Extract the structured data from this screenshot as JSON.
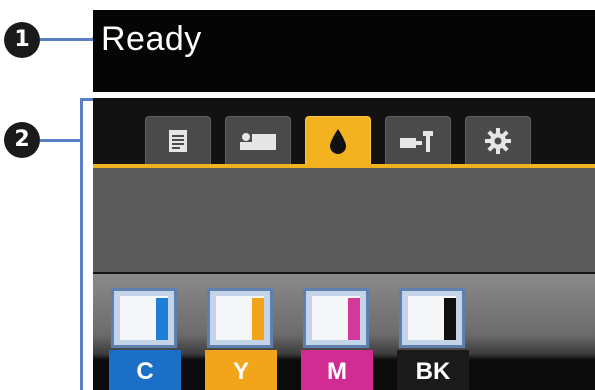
{
  "status": {
    "text": "Ready"
  },
  "callouts": [
    {
      "number": "1"
    },
    {
      "number": "2"
    }
  ],
  "tabs": [
    {
      "icon": "print-queue-icon",
      "active": false
    },
    {
      "icon": "paper-icon",
      "active": false
    },
    {
      "icon": "ink-drop-icon",
      "active": true
    },
    {
      "icon": "maintenance-icon",
      "active": false
    },
    {
      "icon": "settings-gear-icon",
      "active": false
    }
  ],
  "ink": [
    {
      "label": "C",
      "color": "#1f7fd6",
      "label_bg": "#1b6fc7",
      "level": 0.95
    },
    {
      "label": "Y",
      "color": "#f2a51a",
      "label_bg": "#f2a51a",
      "level": 0.95
    },
    {
      "label": "M",
      "color": "#d4399a",
      "label_bg": "#d12c92",
      "level": 0.95
    },
    {
      "label": "BK",
      "color": "#111111",
      "label_bg": "#1a1a1a",
      "level": 0.95
    }
  ],
  "colors": {
    "accent": "#f3b21f",
    "callout_line": "#5a7fc7"
  }
}
